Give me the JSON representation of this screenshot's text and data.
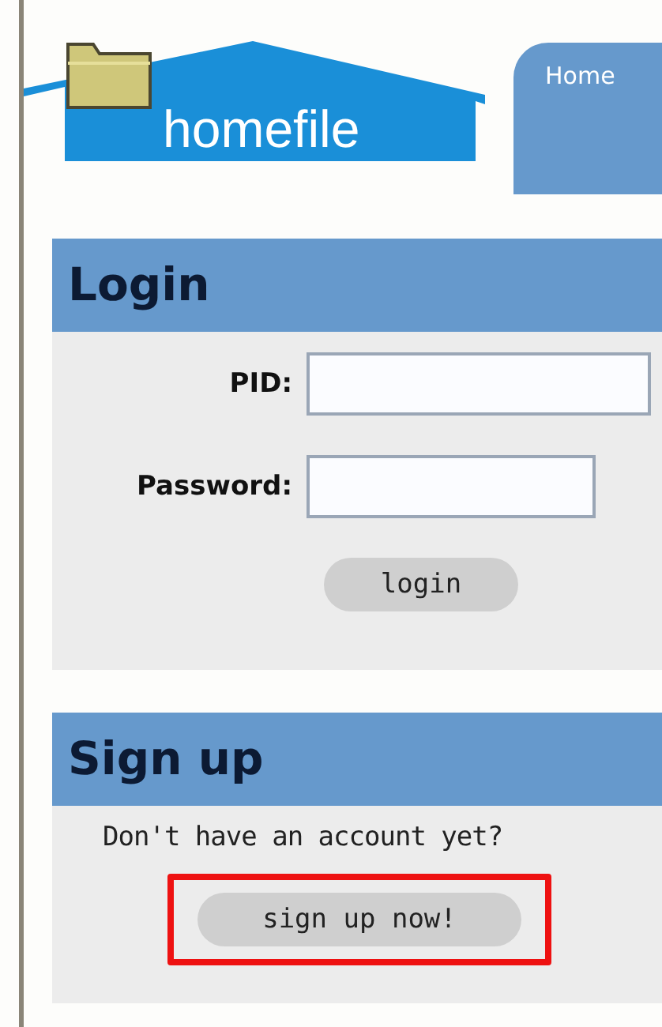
{
  "logo": {
    "text": "homefile"
  },
  "nav_tabs": [
    {
      "label": "Home",
      "selected": true
    }
  ],
  "login": {
    "title": "Login",
    "fields": [
      {
        "label": "PID:",
        "kind": "text"
      },
      {
        "label": "Password:",
        "kind": "password"
      }
    ],
    "button": "login"
  },
  "signup": {
    "title": "Sign up",
    "prompt": "Don't have an account yet?",
    "button": "sign up now!",
    "highlighted": true
  }
}
